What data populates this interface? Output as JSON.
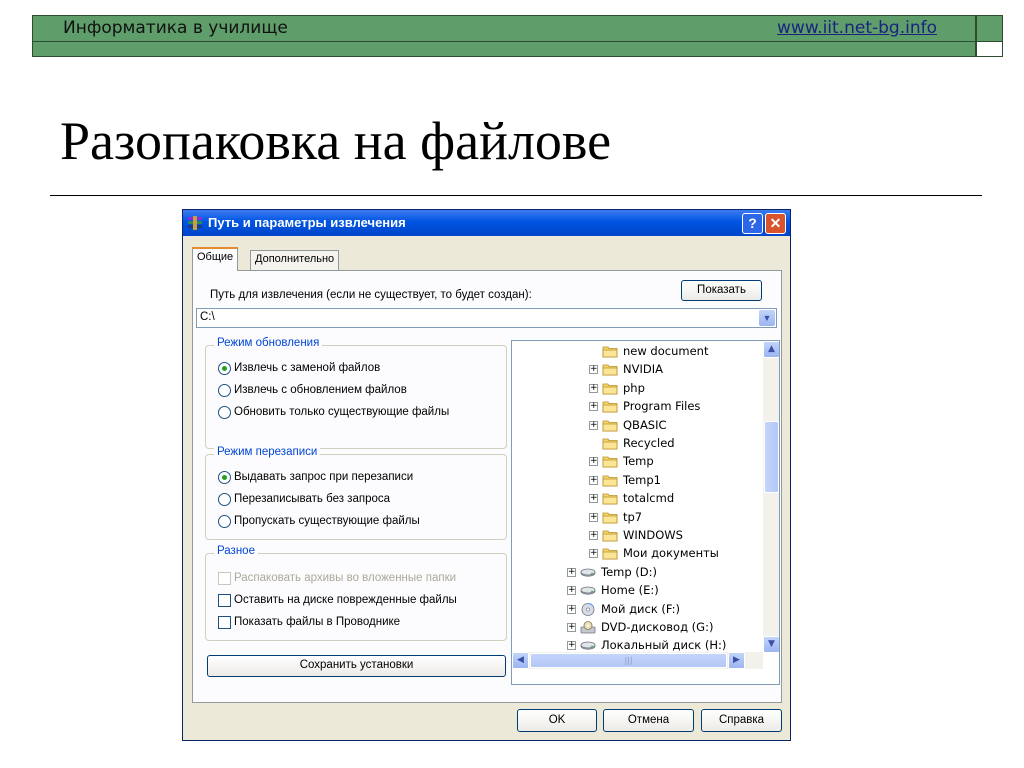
{
  "slide": {
    "header_left": "Информатика в училище",
    "header_right": "www.iit.net-bg.info",
    "title": "Разопаковка на файлове"
  },
  "dialog": {
    "title": "Путь и параметры извлечения",
    "help_glyph": "?",
    "close_glyph": "✕",
    "tabs": [
      {
        "label": "Общие",
        "active": true
      },
      {
        "label": "Дополнительно",
        "active": false
      }
    ],
    "path_label": "Путь для извлечения (если не существует, то будет создан):",
    "show_button": "Показать",
    "path_value": "C:\\",
    "update_mode": {
      "legend": "Режим обновления",
      "options": [
        {
          "label": "Извлечь с заменой файлов",
          "selected": true
        },
        {
          "label": "Извлечь с обновлением файлов",
          "selected": false
        },
        {
          "label": "Обновить только существующие файлы",
          "selected": false
        }
      ]
    },
    "overwrite_mode": {
      "legend": "Режим перезаписи",
      "options": [
        {
          "label": "Выдавать запрос при перезаписи",
          "selected": true
        },
        {
          "label": "Перезаписывать без запроса",
          "selected": false
        },
        {
          "label": "Пропускать существующие файлы",
          "selected": false
        }
      ]
    },
    "misc": {
      "legend": "Разное",
      "options": [
        {
          "label": "Распаковать архивы во вложенные папки",
          "checked": false,
          "disabled": true
        },
        {
          "label": "Оставить на диске поврежденные файлы",
          "checked": false,
          "disabled": false
        },
        {
          "label": "Показать файлы в Проводнике",
          "checked": false,
          "disabled": false
        }
      ]
    },
    "save_button": "Сохранить установки",
    "tree": [
      {
        "label": "new document",
        "icon": "folder-icon",
        "expander": false
      },
      {
        "label": "NVIDIA",
        "icon": "folder-icon",
        "expander": true
      },
      {
        "label": "php",
        "icon": "folder-icon",
        "expander": true
      },
      {
        "label": "Program Files",
        "icon": "folder-icon",
        "expander": true
      },
      {
        "label": "QBASIC",
        "icon": "folder-icon",
        "expander": true
      },
      {
        "label": "Recycled",
        "icon": "folder-icon",
        "expander": false
      },
      {
        "label": "Temp",
        "icon": "folder-icon",
        "expander": true
      },
      {
        "label": "Temp1",
        "icon": "folder-icon",
        "expander": true
      },
      {
        "label": "totalcmd",
        "icon": "folder-icon",
        "expander": true
      },
      {
        "label": "tp7",
        "icon": "folder-icon",
        "expander": true
      },
      {
        "label": "WINDOWS",
        "icon": "folder-icon",
        "expander": true
      },
      {
        "label": "Мои документы",
        "icon": "folder-icon",
        "expander": true
      },
      {
        "label": "Temp (D:)",
        "icon": "drive-icon",
        "expander": true
      },
      {
        "label": "Home (E:)",
        "icon": "drive-icon",
        "expander": true
      },
      {
        "label": "Мой диск (F:)",
        "icon": "cd-drive-icon",
        "expander": true
      },
      {
        "label": "DVD-дисковод (G:)",
        "icon": "dvd-drive-icon",
        "expander": true
      },
      {
        "label": "Локальный диск (H:)",
        "icon": "drive-icon",
        "expander": true
      }
    ],
    "scrollbar_grip": "|||",
    "buttons": {
      "ok": "OK",
      "cancel": "Отмена",
      "help": "Справка"
    }
  }
}
